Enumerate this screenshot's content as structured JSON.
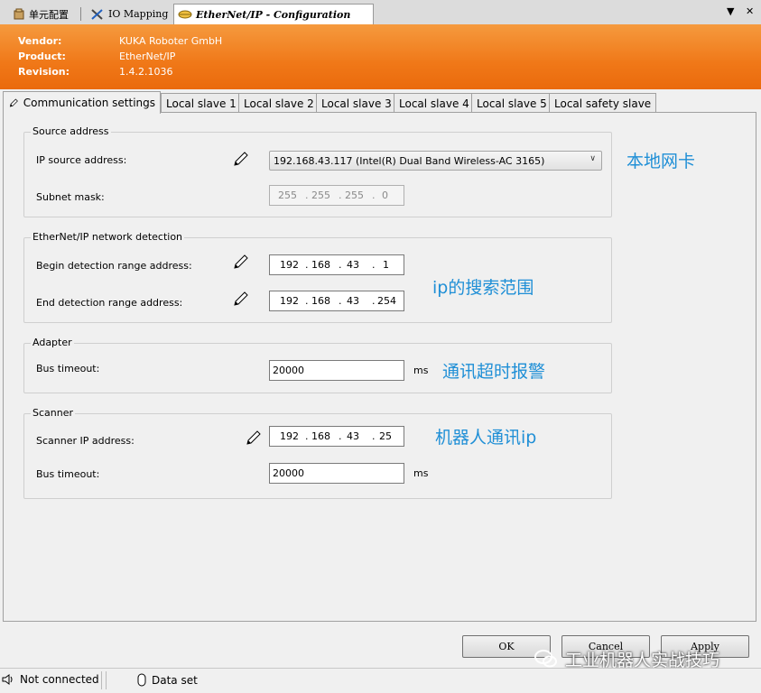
{
  "doc_tabs": {
    "tab1": "单元配置",
    "tab2": "IO Mapping",
    "tab3": "EtherNet/IP - Configuration"
  },
  "vendor_info": {
    "vendor_label": "Vendor:",
    "vendor": "KUKA Roboter GmbH",
    "product_label": "Product:",
    "product": "EtherNet/IP",
    "revision_label": "Revision:",
    "revision": "1.4.2.1036"
  },
  "tabs": [
    "Communication settings",
    "Local slave 1",
    "Local slave 2",
    "Local slave 3",
    "Local slave 4",
    "Local slave 5",
    "Local safety slave"
  ],
  "source": {
    "title": "Source address",
    "ip_label": "IP source address:",
    "ip_value": "192.168.43.117 (Intel(R) Dual Band Wireless-AC 3165)",
    "subnet_label": "Subnet mask:",
    "subnet": [
      "255",
      "255",
      "255",
      "0"
    ]
  },
  "detection": {
    "title": "EtherNet/IP network detection",
    "begin_label": "Begin detection range address:",
    "begin": [
      "192",
      "168",
      "43",
      "1"
    ],
    "end_label": "End detection range address:",
    "end": [
      "192",
      "168",
      "43",
      "254"
    ]
  },
  "adapter": {
    "title": "Adapter",
    "timeout_label": "Bus timeout:",
    "timeout": "20000",
    "unit": "ms"
  },
  "scanner": {
    "title": "Scanner",
    "ip_label": "Scanner IP address:",
    "ip": [
      "192",
      "168",
      "43",
      "25"
    ],
    "timeout_label": "Bus timeout:",
    "timeout": "20000",
    "unit": "ms"
  },
  "annotations": {
    "nic": "本地网卡",
    "range": "ip的搜索范围",
    "timeout": "通讯超时报警",
    "robot_ip": "机器人通讯ip"
  },
  "buttons": {
    "ok": "OK",
    "cancel": "Cancel",
    "apply": "Apply"
  },
  "watermark": "工业机器人实战技巧",
  "status": {
    "connection": "Not connected",
    "dataset": "Data set"
  },
  "colors": {
    "header_orange": "#f07818",
    "annotation_blue": "#1f8fd6"
  }
}
